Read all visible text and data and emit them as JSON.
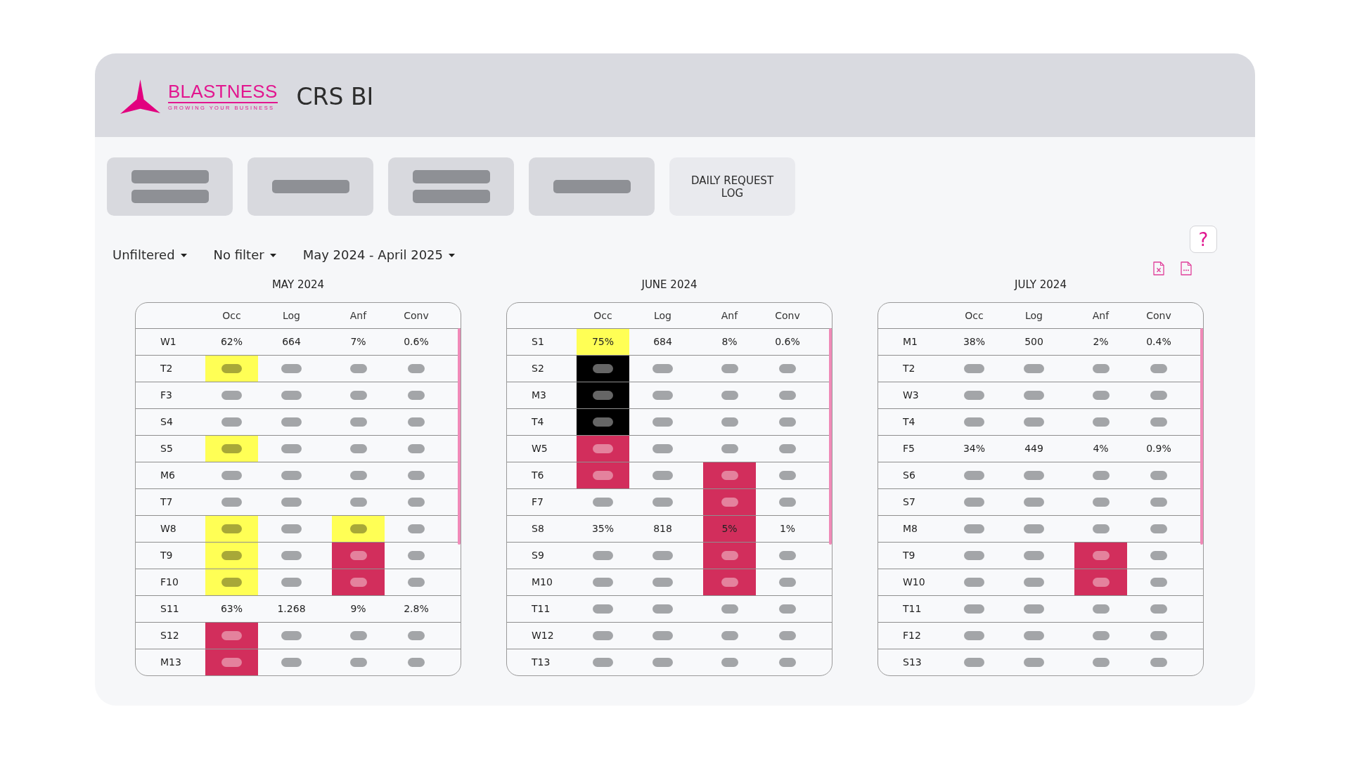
{
  "header": {
    "logo": {
      "name": "BLASTNESS",
      "tagline": "GROWING YOUR BUSINESS"
    },
    "title": "CRS BI"
  },
  "nav_buttons": [
    {
      "kind": "redacted_double",
      "selected": false
    },
    {
      "kind": "redacted_single",
      "selected": false
    },
    {
      "kind": "redacted_double",
      "selected": false
    },
    {
      "kind": "redacted_single",
      "selected": false
    },
    {
      "kind": "text",
      "label": "DAILY REQUEST LOG",
      "selected": true
    }
  ],
  "filters": [
    {
      "label": "Unfiltered"
    },
    {
      "label": "No filter"
    },
    {
      "label": "May 2024 - April 2025"
    }
  ],
  "help_button": {
    "label": "?"
  },
  "months": [
    {
      "title": "MAY 2024",
      "columns": [
        "Occ",
        "Log",
        "Anf",
        "Conv"
      ],
      "rows": [
        {
          "label": "W1",
          "cells": [
            {
              "kind": "value",
              "value": "62%"
            },
            {
              "kind": "value",
              "value": "664"
            },
            {
              "kind": "value",
              "value": "7%"
            },
            {
              "kind": "value",
              "value": "0.6%"
            }
          ]
        },
        {
          "label": "T2",
          "cells": [
            {
              "kind": "redacted",
              "color": "#ffff55"
            },
            {
              "kind": "redacted"
            },
            {
              "kind": "redacted"
            },
            {
              "kind": "redacted"
            }
          ]
        },
        {
          "label": "F3",
          "cells": [
            {
              "kind": "redacted"
            },
            {
              "kind": "redacted"
            },
            {
              "kind": "redacted"
            },
            {
              "kind": "redacted"
            }
          ]
        },
        {
          "label": "S4",
          "cells": [
            {
              "kind": "redacted"
            },
            {
              "kind": "redacted"
            },
            {
              "kind": "redacted"
            },
            {
              "kind": "redacted"
            }
          ]
        },
        {
          "label": "S5",
          "cells": [
            {
              "kind": "redacted",
              "color": "#ffff55"
            },
            {
              "kind": "redacted"
            },
            {
              "kind": "redacted"
            },
            {
              "kind": "redacted"
            }
          ]
        },
        {
          "label": "M6",
          "cells": [
            {
              "kind": "redacted"
            },
            {
              "kind": "redacted"
            },
            {
              "kind": "redacted"
            },
            {
              "kind": "redacted"
            }
          ]
        },
        {
          "label": "T7",
          "cells": [
            {
              "kind": "redacted"
            },
            {
              "kind": "redacted"
            },
            {
              "kind": "redacted"
            },
            {
              "kind": "redacted"
            }
          ]
        },
        {
          "label": "W8",
          "cells": [
            {
              "kind": "redacted",
              "color": "#ffff55"
            },
            {
              "kind": "redacted"
            },
            {
              "kind": "redacted",
              "color": "#ffff55"
            },
            {
              "kind": "redacted"
            }
          ]
        },
        {
          "label": "T9",
          "cells": [
            {
              "kind": "redacted",
              "color": "#ffff55"
            },
            {
              "kind": "redacted"
            },
            {
              "kind": "redacted",
              "color": "#d22e5c"
            },
            {
              "kind": "redacted"
            }
          ]
        },
        {
          "label": "F10",
          "cells": [
            {
              "kind": "redacted",
              "color": "#ffff55"
            },
            {
              "kind": "redacted"
            },
            {
              "kind": "redacted",
              "color": "#d22e5c"
            },
            {
              "kind": "redacted"
            }
          ]
        },
        {
          "label": "S11",
          "cells": [
            {
              "kind": "value",
              "value": "63%"
            },
            {
              "kind": "value",
              "value": "1.268"
            },
            {
              "kind": "value",
              "value": "9%"
            },
            {
              "kind": "value",
              "value": "2.8%"
            }
          ]
        },
        {
          "label": "S12",
          "cells": [
            {
              "kind": "redacted",
              "color": "#d22e5c"
            },
            {
              "kind": "redacted"
            },
            {
              "kind": "redacted"
            },
            {
              "kind": "redacted"
            }
          ]
        },
        {
          "label": "M13",
          "cells": [
            {
              "kind": "redacted",
              "color": "#d22e5c"
            },
            {
              "kind": "redacted"
            },
            {
              "kind": "redacted"
            },
            {
              "kind": "redacted"
            }
          ]
        }
      ]
    },
    {
      "title": "JUNE 2024",
      "columns": [
        "Occ",
        "Log",
        "Anf",
        "Conv"
      ],
      "rows": [
        {
          "label": "S1",
          "cells": [
            {
              "kind": "value",
              "value": "75%",
              "color": "#ffff55"
            },
            {
              "kind": "value",
              "value": "684"
            },
            {
              "kind": "value",
              "value": "8%"
            },
            {
              "kind": "value",
              "value": "0.6%"
            }
          ]
        },
        {
          "label": "S2",
          "cells": [
            {
              "kind": "redacted",
              "color": "#000000"
            },
            {
              "kind": "redacted"
            },
            {
              "kind": "redacted"
            },
            {
              "kind": "redacted"
            }
          ]
        },
        {
          "label": "M3",
          "cells": [
            {
              "kind": "redacted",
              "color": "#000000"
            },
            {
              "kind": "redacted"
            },
            {
              "kind": "redacted"
            },
            {
              "kind": "redacted"
            }
          ]
        },
        {
          "label": "T4",
          "cells": [
            {
              "kind": "redacted",
              "color": "#000000"
            },
            {
              "kind": "redacted"
            },
            {
              "kind": "redacted"
            },
            {
              "kind": "redacted"
            }
          ]
        },
        {
          "label": "W5",
          "cells": [
            {
              "kind": "redacted",
              "color": "#d22e5c"
            },
            {
              "kind": "redacted"
            },
            {
              "kind": "redacted"
            },
            {
              "kind": "redacted"
            }
          ]
        },
        {
          "label": "T6",
          "cells": [
            {
              "kind": "redacted",
              "color": "#d22e5c"
            },
            {
              "kind": "redacted"
            },
            {
              "kind": "redacted",
              "color": "#d22e5c"
            },
            {
              "kind": "redacted"
            }
          ]
        },
        {
          "label": "F7",
          "cells": [
            {
              "kind": "redacted"
            },
            {
              "kind": "redacted"
            },
            {
              "kind": "redacted",
              "color": "#d22e5c"
            },
            {
              "kind": "redacted"
            }
          ]
        },
        {
          "label": "S8",
          "cells": [
            {
              "kind": "value",
              "value": "35%"
            },
            {
              "kind": "value",
              "value": "818"
            },
            {
              "kind": "value",
              "value": "5%",
              "color": "#d22e5c"
            },
            {
              "kind": "value",
              "value": "1%"
            }
          ]
        },
        {
          "label": "S9",
          "cells": [
            {
              "kind": "redacted"
            },
            {
              "kind": "redacted"
            },
            {
              "kind": "redacted",
              "color": "#d22e5c"
            },
            {
              "kind": "redacted"
            }
          ]
        },
        {
          "label": "M10",
          "cells": [
            {
              "kind": "redacted"
            },
            {
              "kind": "redacted"
            },
            {
              "kind": "redacted",
              "color": "#d22e5c"
            },
            {
              "kind": "redacted"
            }
          ]
        },
        {
          "label": "T11",
          "cells": [
            {
              "kind": "redacted"
            },
            {
              "kind": "redacted"
            },
            {
              "kind": "redacted"
            },
            {
              "kind": "redacted"
            }
          ]
        },
        {
          "label": "W12",
          "cells": [
            {
              "kind": "redacted"
            },
            {
              "kind": "redacted"
            },
            {
              "kind": "redacted"
            },
            {
              "kind": "redacted"
            }
          ]
        },
        {
          "label": "T13",
          "cells": [
            {
              "kind": "redacted"
            },
            {
              "kind": "redacted"
            },
            {
              "kind": "redacted"
            },
            {
              "kind": "redacted"
            }
          ]
        }
      ]
    },
    {
      "title": "JULY 2024",
      "columns": [
        "Occ",
        "Log",
        "Anf",
        "Conv"
      ],
      "rows": [
        {
          "label": "M1",
          "cells": [
            {
              "kind": "value",
              "value": "38%"
            },
            {
              "kind": "value",
              "value": "500"
            },
            {
              "kind": "value",
              "value": "2%"
            },
            {
              "kind": "value",
              "value": "0.4%"
            }
          ]
        },
        {
          "label": "T2",
          "cells": [
            {
              "kind": "redacted"
            },
            {
              "kind": "redacted"
            },
            {
              "kind": "redacted"
            },
            {
              "kind": "redacted"
            }
          ]
        },
        {
          "label": "W3",
          "cells": [
            {
              "kind": "redacted"
            },
            {
              "kind": "redacted"
            },
            {
              "kind": "redacted"
            },
            {
              "kind": "redacted"
            }
          ]
        },
        {
          "label": "T4",
          "cells": [
            {
              "kind": "redacted"
            },
            {
              "kind": "redacted"
            },
            {
              "kind": "redacted"
            },
            {
              "kind": "redacted"
            }
          ]
        },
        {
          "label": "F5",
          "cells": [
            {
              "kind": "value",
              "value": "34%"
            },
            {
              "kind": "value",
              "value": "449"
            },
            {
              "kind": "value",
              "value": "4%"
            },
            {
              "kind": "value",
              "value": "0.9%"
            }
          ]
        },
        {
          "label": "S6",
          "cells": [
            {
              "kind": "redacted"
            },
            {
              "kind": "redacted"
            },
            {
              "kind": "redacted"
            },
            {
              "kind": "redacted"
            }
          ]
        },
        {
          "label": "S7",
          "cells": [
            {
              "kind": "redacted"
            },
            {
              "kind": "redacted"
            },
            {
              "kind": "redacted"
            },
            {
              "kind": "redacted"
            }
          ]
        },
        {
          "label": "M8",
          "cells": [
            {
              "kind": "redacted"
            },
            {
              "kind": "redacted"
            },
            {
              "kind": "redacted"
            },
            {
              "kind": "redacted"
            }
          ]
        },
        {
          "label": "T9",
          "cells": [
            {
              "kind": "redacted"
            },
            {
              "kind": "redacted"
            },
            {
              "kind": "redacted",
              "color": "#d22e5c"
            },
            {
              "kind": "redacted"
            }
          ]
        },
        {
          "label": "W10",
          "cells": [
            {
              "kind": "redacted"
            },
            {
              "kind": "redacted"
            },
            {
              "kind": "redacted",
              "color": "#d22e5c"
            },
            {
              "kind": "redacted"
            }
          ]
        },
        {
          "label": "T11",
          "cells": [
            {
              "kind": "redacted"
            },
            {
              "kind": "redacted"
            },
            {
              "kind": "redacted"
            },
            {
              "kind": "redacted"
            }
          ]
        },
        {
          "label": "F12",
          "cells": [
            {
              "kind": "redacted"
            },
            {
              "kind": "redacted"
            },
            {
              "kind": "redacted"
            },
            {
              "kind": "redacted"
            }
          ]
        },
        {
          "label": "S13",
          "cells": [
            {
              "kind": "redacted"
            },
            {
              "kind": "redacted"
            },
            {
              "kind": "redacted"
            },
            {
              "kind": "redacted"
            }
          ]
        }
      ]
    }
  ]
}
